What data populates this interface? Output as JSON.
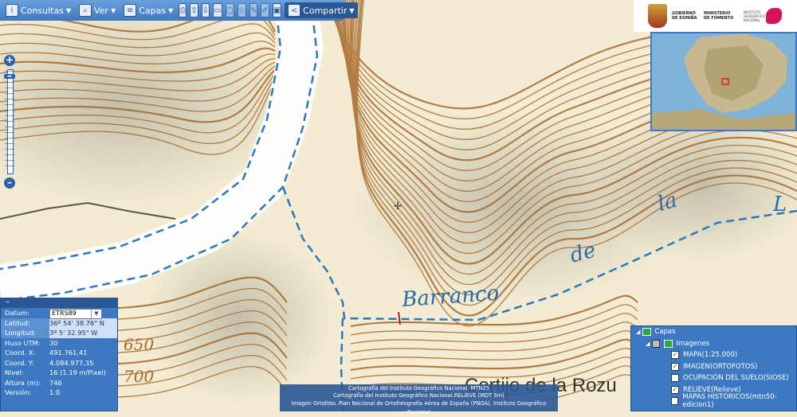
{
  "toolbar": {
    "consultas": "Consultas",
    "ver": "Ver",
    "capas": "Capas",
    "compartir": "Compartir"
  },
  "header": {
    "gobierno": "GOBIERNO DE ESPAÑA",
    "ministerio": "MINISTERIO DE FOMENTO",
    "instituto": "INSTITUTO GEOGRÁFICO NACIONAL"
  },
  "map_labels": {
    "barranco": "Barranco",
    "de": "de",
    "la": "la",
    "la2": "L",
    "cortijo": "Cortijo de la Rozu",
    "elev_650": "650",
    "elev_700": "700"
  },
  "info_panel": {
    "toggle": "–",
    "rows": [
      {
        "label": "Datum:",
        "value": "ETRS89"
      },
      {
        "label": "Latitud:",
        "value": "36º 54' 38.76\" N"
      },
      {
        "label": "Longitud:",
        "value": "3º 5' 32.95\" W"
      },
      {
        "label": "Huso UTM:",
        "value": "30"
      },
      {
        "label": "Coord. X:",
        "value": "491.761,41"
      },
      {
        "label": "Coord. Y:",
        "value": "4.084.977,35"
      },
      {
        "label": "Nivel:",
        "value": "16 (1.19 m/Pixel)"
      },
      {
        "label": "Altura (m):",
        "value": "746"
      },
      {
        "label": "Versión:",
        "value": "1.0"
      }
    ]
  },
  "layers_panel": {
    "root": "Capas",
    "group": "Imagenes",
    "items": [
      {
        "label": "MAPA(1:25.000)",
        "checked": true
      },
      {
        "label": "IMAGEN(ORTOFOTOS)",
        "checked": true
      },
      {
        "label": "OCUPACIÓN DEL SUELO(SIOSE)",
        "checked": false
      },
      {
        "label": "RELIEVE(Relieve)",
        "checked": true
      },
      {
        "label": "MAPAS HISTÓRICOS(mtn50-edicion1)",
        "checked": false
      }
    ]
  },
  "credits": [
    "Cartografía del Instituto Geográfico Nacional. MTN25",
    "Cartografía del Instituto Geográfico Nacional.RELIEVE (MDT 5m)",
    "Imagen Ortofoto. Plan Nacional de Ortofotografía Aérea de España (PNOA). Instituto Geográfico Nacional"
  ],
  "colors": {
    "panel": "#3d78c2",
    "contour": "#a8692a",
    "water": "#2a78c0",
    "map_bg": "#f3ecd2"
  }
}
